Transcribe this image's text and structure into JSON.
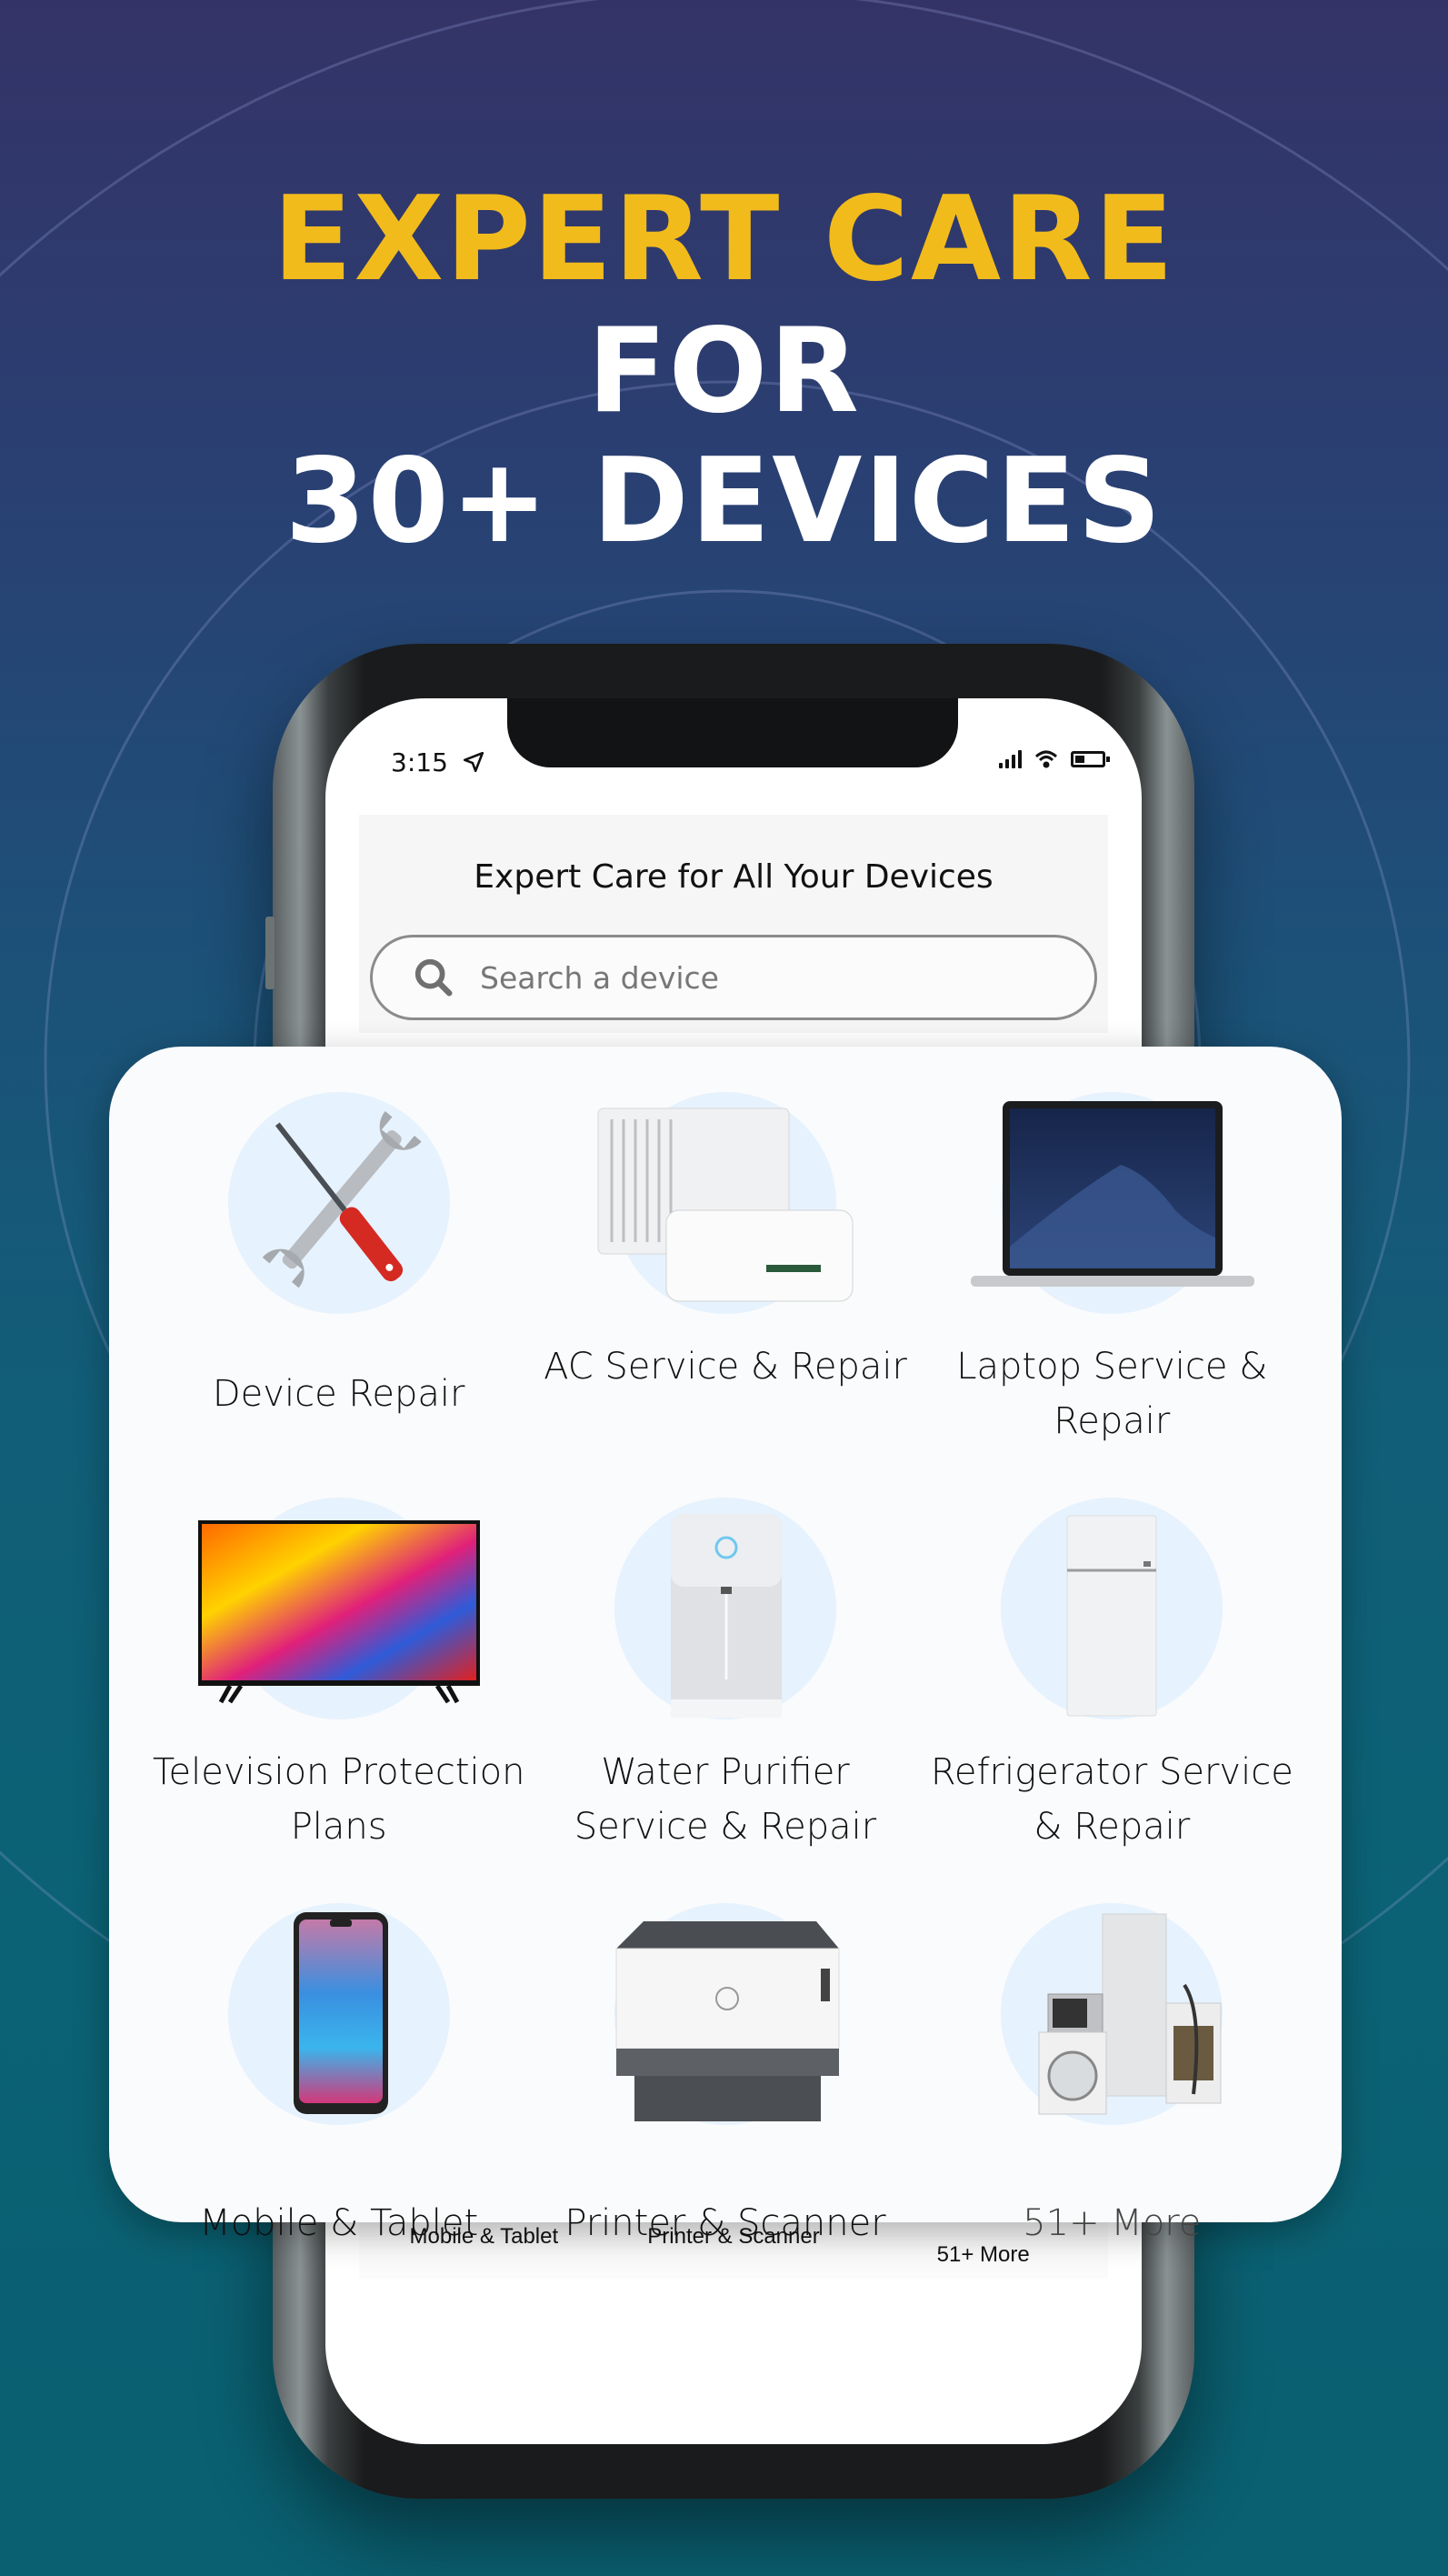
{
  "headline": {
    "line1": "EXPERT CARE",
    "line2": "FOR",
    "line3": "30+ DEVICES",
    "accent_color": "#f2bb1c"
  },
  "status_bar": {
    "time": "3:15",
    "location_icon": "location-arrow-icon",
    "signal_icon": "cellular-signal-icon",
    "wifi_icon": "wifi-icon",
    "battery_icon": "battery-icon",
    "battery_level": 0.35
  },
  "app": {
    "title": "Expert Care for All Your Devices",
    "search": {
      "placeholder": "Search a device",
      "value": ""
    }
  },
  "categories": [
    {
      "label": "Device Repair",
      "icon": "tools-icon"
    },
    {
      "label": "AC Service & Repair",
      "icon": "air-conditioner-icon"
    },
    {
      "label": "Laptop Service & Repair",
      "icon": "laptop-icon"
    },
    {
      "label": "Television Protection Plans",
      "icon": "television-icon"
    },
    {
      "label": "Water Purifier Service & Repair",
      "icon": "water-purifier-icon"
    },
    {
      "label": "Refrigerator Service & Repair",
      "icon": "refrigerator-icon"
    },
    {
      "label": "Mobile & Tablet",
      "icon": "mobile-phone-icon"
    },
    {
      "label": "Printer & Scanner",
      "icon": "printer-icon"
    },
    {
      "label": "51+ More",
      "icon": "appliances-icon"
    }
  ],
  "background_row": [
    {
      "label": "Mobile & Tablet"
    },
    {
      "label": "Printer & Scanner"
    },
    {
      "label": "51+ More"
    }
  ]
}
